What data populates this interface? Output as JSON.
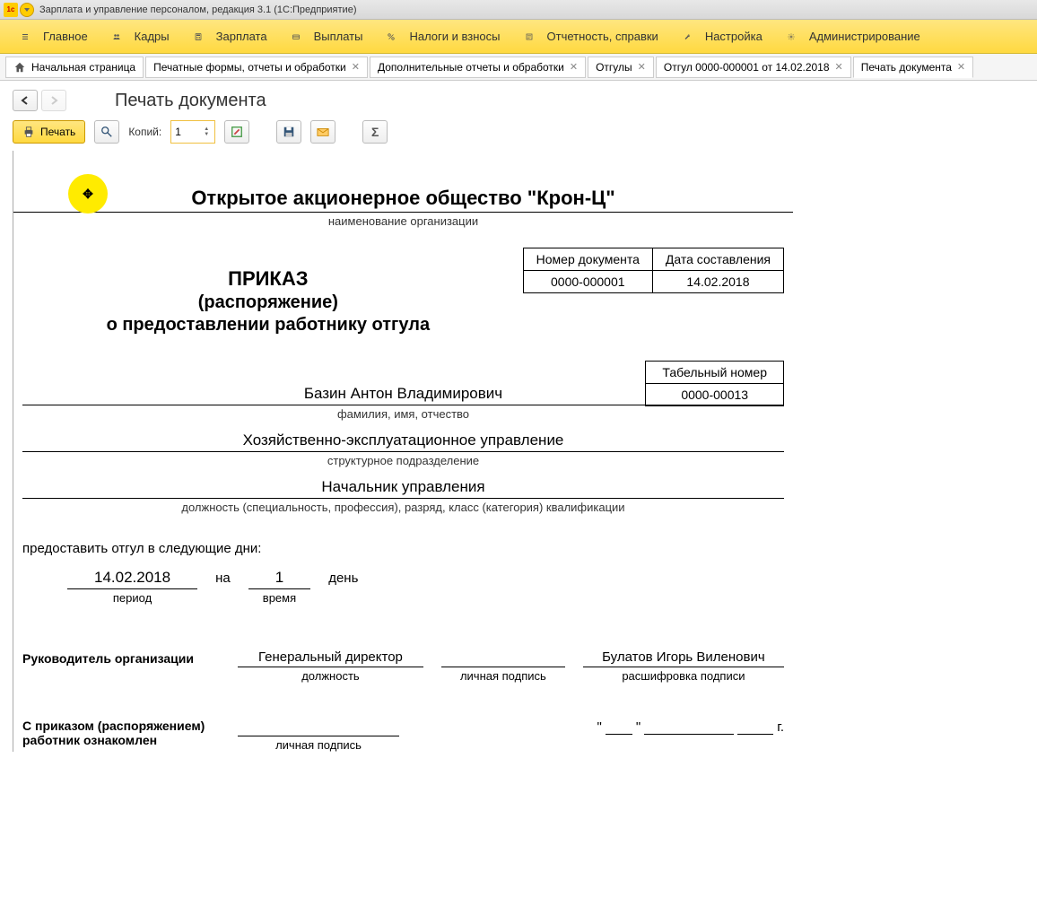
{
  "titlebar": {
    "text": "Зарплата и управление персоналом, редакция 3.1  (1С:Предприятие)"
  },
  "mainmenu": {
    "items": [
      {
        "label": "Главное"
      },
      {
        "label": "Кадры"
      },
      {
        "label": "Зарплата"
      },
      {
        "label": "Выплаты"
      },
      {
        "label": "Налоги и взносы"
      },
      {
        "label": "Отчетность, справки"
      },
      {
        "label": "Настройка"
      },
      {
        "label": "Администрирование"
      }
    ]
  },
  "tabs": {
    "items": [
      {
        "label": "Начальная страница",
        "closable": false,
        "home": true
      },
      {
        "label": "Печатные формы, отчеты и обработки",
        "closable": true
      },
      {
        "label": "Дополнительные отчеты и обработки",
        "closable": true
      },
      {
        "label": "Отгулы",
        "closable": true
      },
      {
        "label": "Отгул 0000-000001 от 14.02.2018",
        "closable": true
      },
      {
        "label": "Печать документа",
        "closable": true,
        "active": true
      }
    ]
  },
  "pagetitle": "Печать документа",
  "toolbar": {
    "print_label": "Печать",
    "copies_label": "Копий:",
    "copies_value": "1"
  },
  "doc": {
    "org_name": "Открытое акционерное общество \"Крон-Ц\"",
    "org_sub": "наименование организации",
    "header": {
      "col1_label": "Номер документа",
      "col2_label": "Дата составления",
      "col1_val": "0000-000001",
      "col2_val": "14.02.2018"
    },
    "prikaz": {
      "p1": "ПРИКАЗ",
      "p2": "(распоряжение)",
      "p3": "о предоставлении работнику отгула"
    },
    "tabno": {
      "label": "Табельный номер",
      "val": "0000-00013"
    },
    "fio": {
      "val": "Базин Антон Владимирович",
      "sub": "фамилия, имя, отчество"
    },
    "dept": {
      "val": "Хозяйственно-эксплуатационное управление",
      "sub": "структурное подразделение"
    },
    "position": {
      "val": "Начальник управления",
      "sub": "должность (специальность, профессия), разряд, класс (категория) квалификации"
    },
    "body_text": "предоставить отгул в следующие дни:",
    "period": {
      "date": "14.02.2018",
      "date_sub": "период",
      "mid": "на",
      "days": "1",
      "days_sub": "время",
      "tail": "день"
    },
    "sign": {
      "label": "Руководитель организации",
      "position": "Генеральный директор",
      "position_sub": "должность",
      "signature_sub": "личная подпись",
      "name": "Булатов Игорь Виленович",
      "name_sub": "расшифровка подписи"
    },
    "ack": {
      "label1": "С приказом (распоряжением)",
      "label2": "работник ознакомлен",
      "sign_sub": "личная подпись",
      "date_q1": "\"",
      "date_q2": "\"",
      "date_tail": "г."
    }
  }
}
